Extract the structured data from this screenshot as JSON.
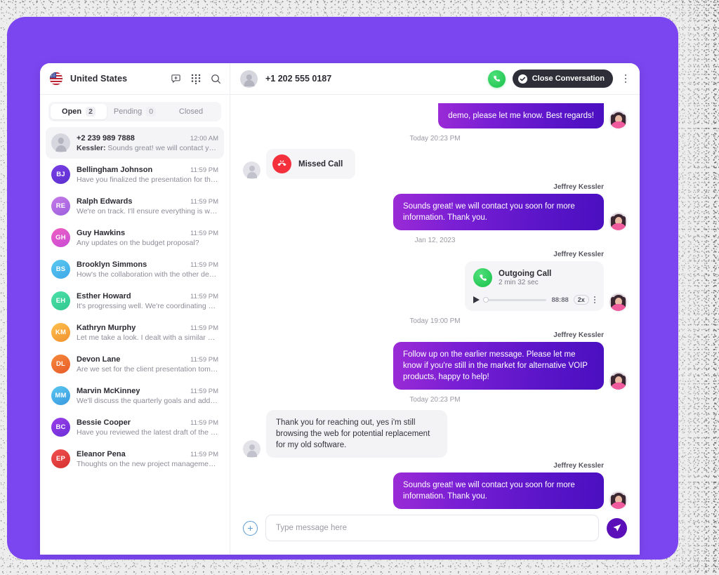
{
  "theme": {
    "card_purple": "#7B46F0",
    "bubble_out_start": "#9B2BD6",
    "bubble_out_end": "#4A0FC0",
    "accent_green": "#18C04A",
    "missed_red": "#F4303C",
    "send_button": "#5A0FB8",
    "dark_button": "#2E2E38"
  },
  "sidebar": {
    "country": "United States",
    "flag_icon": "us-flag-icon",
    "header_icons": [
      {
        "name": "new-message-icon"
      },
      {
        "name": "dialpad-icon"
      },
      {
        "name": "search-icon"
      }
    ],
    "tabs": [
      {
        "label": "Open",
        "count": "2",
        "active": true
      },
      {
        "label": "Pending",
        "count": "0",
        "active": false
      },
      {
        "label": "Closed",
        "count": "",
        "active": false
      }
    ],
    "conversations": [
      {
        "name": "+2 239 989 7888",
        "time": "12:00 AM",
        "preview_sender": "Kessler:",
        "preview": " Sounds great! we will contact you s…",
        "initials": "",
        "avatar_type": "generic",
        "color_a": "#D6D6DE",
        "color_b": "#D6D6DE",
        "selected": true
      },
      {
        "name": "Bellingham Johnson",
        "time": "11:59 PM",
        "preview_sender": "",
        "preview": "Have you finalized the presentation for the…",
        "initials": "BJ",
        "avatar_type": "initials",
        "color_a": "#7B3FE4",
        "color_b": "#5B2FD0",
        "selected": false
      },
      {
        "name": "Ralph Edwards",
        "time": "11:59 PM",
        "preview_sender": "",
        "preview": "We're on track. I'll ensure everything is wrap…",
        "initials": "RE",
        "avatar_type": "initials",
        "color_a": "#C77BE8",
        "color_b": "#9B5FDD",
        "selected": false
      },
      {
        "name": "Guy Hawkins",
        "time": "11:59 PM",
        "preview_sender": "",
        "preview": "Any updates on the budget proposal?",
        "initials": "GH",
        "avatar_type": "initials",
        "color_a": "#EE5FC0",
        "color_b": "#C84BD8",
        "selected": false
      },
      {
        "name": "Brooklyn Simmons",
        "time": "11:59 PM",
        "preview_sender": "",
        "preview": "How's the collaboration with the other depa…",
        "initials": "BS",
        "avatar_type": "initials",
        "color_a": "#5BC8F0",
        "color_b": "#3DA8E8",
        "selected": false
      },
      {
        "name": "Esther Howard",
        "time": "11:59 PM",
        "preview_sender": "",
        "preview": "It's progressing well. We're coordinating clo…",
        "initials": "EH",
        "avatar_type": "initials",
        "color_a": "#4BE0A8",
        "color_b": "#30C890",
        "selected": false
      },
      {
        "name": "Kathryn Murphy",
        "time": "11:59 PM",
        "preview_sender": "",
        "preview": "Let me take a look. I dealt with a similar pro…",
        "initials": "KM",
        "avatar_type": "initials",
        "color_a": "#FFC14D",
        "color_b": "#F09030",
        "selected": false
      },
      {
        "name": "Devon Lane",
        "time": "11:59 PM",
        "preview_sender": "",
        "preview": "Are we set for the client presentation tomor…",
        "initials": "DL",
        "avatar_type": "initials",
        "color_a": "#F58A3C",
        "color_b": "#E85A2A",
        "selected": false
      },
      {
        "name": "Marvin McKinney",
        "time": "11:59 PM",
        "preview_sender": "",
        "preview": "We'll discuss the quarterly goals and addre…",
        "initials": "MM",
        "avatar_type": "initials",
        "color_a": "#5BC8F0",
        "color_b": "#3898E0",
        "selected": false
      },
      {
        "name": "Bessie Cooper",
        "time": "11:59 PM",
        "preview_sender": "",
        "preview": "Have you reviewed the latest draft of the pr…",
        "initials": "BC",
        "avatar_type": "initials",
        "color_a": "#9B3FE8",
        "color_b": "#6B2FD8",
        "selected": false
      },
      {
        "name": "Eleanor Pena",
        "time": "11:59 PM",
        "preview_sender": "",
        "preview": "Thoughts on the new project management t…",
        "initials": "EP",
        "avatar_type": "initials",
        "color_a": "#F05050",
        "color_b": "#D63030",
        "selected": false
      }
    ]
  },
  "chat": {
    "peer_name": "+1 202 555 0187",
    "peer_avatar": "generic-user-avatar",
    "call_button_icon": "phone-icon",
    "close_conversation_label": "Close Conversation",
    "close_conversation_icon": "check-circle-icon",
    "more_menu_icon": "kebab-menu-icon",
    "messages": [
      {
        "kind": "text",
        "direction": "out",
        "sender": "",
        "text": "demo, please let me know. Best regards!",
        "clipped": true
      },
      {
        "kind": "separator",
        "label": "Today 20:23 PM"
      },
      {
        "kind": "missed_call",
        "direction": "in",
        "label": "Missed Call",
        "icon": "missed-call-icon"
      },
      {
        "kind": "text",
        "direction": "out",
        "sender": "Jeffrey Kessler",
        "text": "Sounds great! we will contact you soon for more information. Thank you."
      },
      {
        "kind": "separator",
        "label": "Jan 12, 2023"
      },
      {
        "kind": "call_recording",
        "direction": "out",
        "sender": "Jeffrey Kessler",
        "title": "Outgoing Call",
        "duration": "2 min 32 sec",
        "icon": "outgoing-call-icon",
        "timecode": "88:88",
        "speed": "2x",
        "progress": 0
      },
      {
        "kind": "separator",
        "label": "Today 19:00 PM"
      },
      {
        "kind": "text",
        "direction": "out",
        "sender": "Jeffrey Kessler",
        "text": "Follow up on the earlier message. Please let me know if you're still in the market for alternative VOIP products, happy to help!"
      },
      {
        "kind": "separator",
        "label": "Today 20:23 PM"
      },
      {
        "kind": "text",
        "direction": "in",
        "sender": "",
        "text": "Thank you for reaching out, yes i'm still browsing the web for potential replacement for my old software."
      },
      {
        "kind": "text",
        "direction": "out",
        "sender": "Jeffrey Kessler",
        "text": "Sounds great! we will contact you soon for more information. Thank you."
      }
    ],
    "composer": {
      "attach_icon": "plus-circle-icon",
      "placeholder": "Type message here",
      "value": "",
      "send_icon": "send-icon"
    }
  }
}
